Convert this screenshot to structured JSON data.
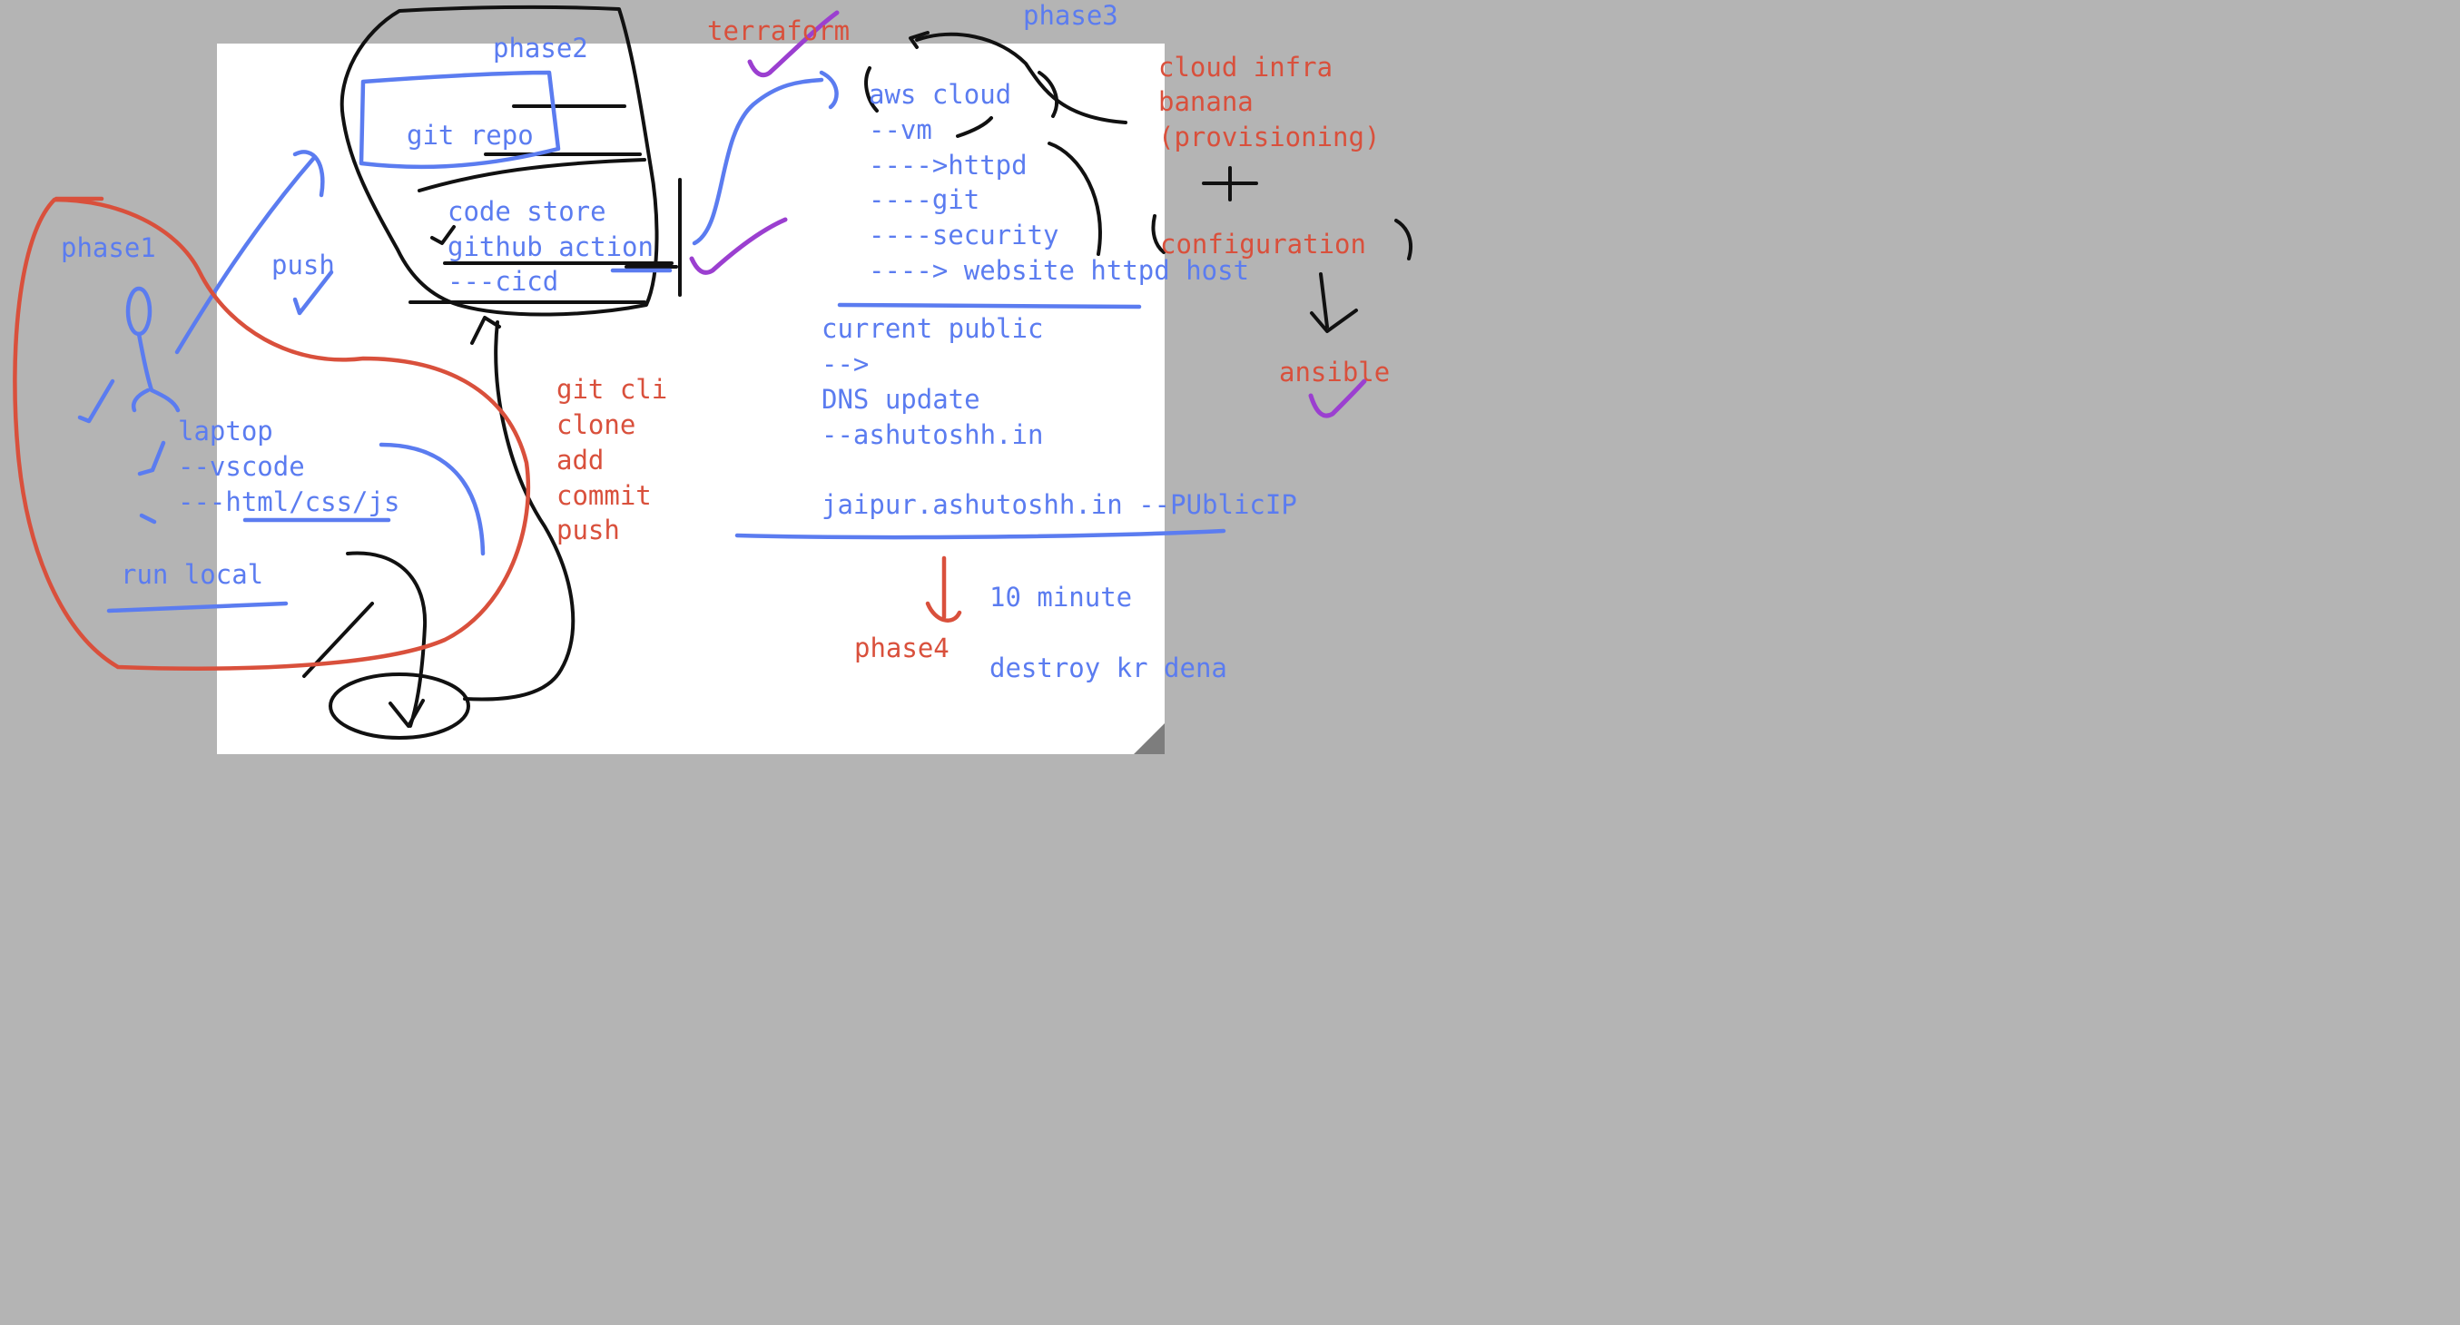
{
  "colors": {
    "blue": "#5b7cf0",
    "red": "#d9503c",
    "black": "#111111",
    "purple": "#9b3fd0",
    "canvas": "#ffffff",
    "background": "#b4b4b4"
  },
  "labels": {
    "phase1": "phase1",
    "phase2": "phase2",
    "phase3": "phase3",
    "phase4": "phase4",
    "terraform": "terraform",
    "push": "push",
    "ansible": "ansible",
    "run_local": "run local",
    "ten_minute": "10 minute",
    "destroy": "destroy kr dena"
  },
  "laptop_stack": [
    "laptop",
    "--vscode",
    "---html/css/js"
  ],
  "repo_box": {
    "title": "git repo",
    "lines": [
      "code store",
      "github action",
      "---cicd"
    ]
  },
  "git_cli": [
    "git cli",
    "clone",
    "add",
    "commit",
    "push"
  ],
  "cloud_stack": [
    "aws cloud",
    "--vm",
    "---->httpd",
    "----git",
    "----security",
    "----> website httpd host"
  ],
  "dns_stack": [
    "current public",
    "-->",
    "DNS update",
    "--ashutoshh.in"
  ],
  "public_ip": "jaipur.ashutoshh.in --PUblicIP",
  "infra_notes": [
    "cloud infra",
    "banana",
    "(provisioning)"
  ],
  "plus": "+",
  "configuration": "configuration"
}
